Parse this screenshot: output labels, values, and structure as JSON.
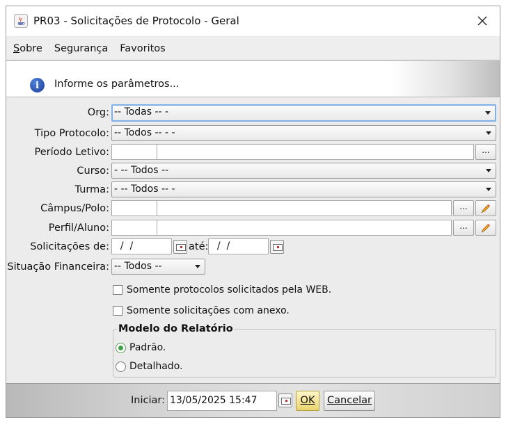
{
  "window": {
    "title": "PR03 - Solicitações de Protocolo - Geral"
  },
  "menu": {
    "items": [
      {
        "label": "Sobre",
        "mnemonic": "S",
        "rest": "obre"
      },
      {
        "label": "Segurança"
      },
      {
        "label": "Favoritos"
      }
    ]
  },
  "info": {
    "message": "Informe os parâmetros...",
    "icon": "info-icon"
  },
  "form": {
    "org": {
      "label": "Org:",
      "value": "-- Todas -- -"
    },
    "tipo_protocolo": {
      "label": "Tipo Protocolo:",
      "value": "-- Todos -- -  -"
    },
    "periodo_letivo": {
      "label": "Período Letivo:",
      "code": "",
      "description": "",
      "button": "..."
    },
    "curso": {
      "label": "Curso:",
      "value": "- -- Todos --"
    },
    "turma": {
      "label": "Turma:",
      "value": "- -- Todos -- -"
    },
    "campus_polo": {
      "label": "Câmpus/Polo:",
      "code": "",
      "description": "",
      "button": "..."
    },
    "perfil_aluno": {
      "label": "Perfil/Aluno:",
      "code": "",
      "description": "",
      "button": "..."
    },
    "solicitacoes": {
      "label": "Solicitações de:",
      "from": "  /  /",
      "ate_label": "até:",
      "to": "  /  /"
    },
    "situacao_financeira": {
      "label": "Situação Financeira:",
      "value": "-- Todos --"
    },
    "somente_web": {
      "label": "Somente protocolos solicitados pela WEB.",
      "checked": false
    },
    "somente_anexo": {
      "label": "Somente solicitações com anexo.",
      "checked": false
    },
    "modelo": {
      "title": "Modelo do Relatório",
      "options": [
        {
          "label": "Padrão.",
          "checked": true
        },
        {
          "label": "Detalhado.",
          "checked": false
        }
      ]
    }
  },
  "footer": {
    "iniciar_label": "Iniciar:",
    "iniciar_value": "13/05/2025 15:47",
    "ok_label": "OK",
    "cancel_label": "Cancelar"
  }
}
